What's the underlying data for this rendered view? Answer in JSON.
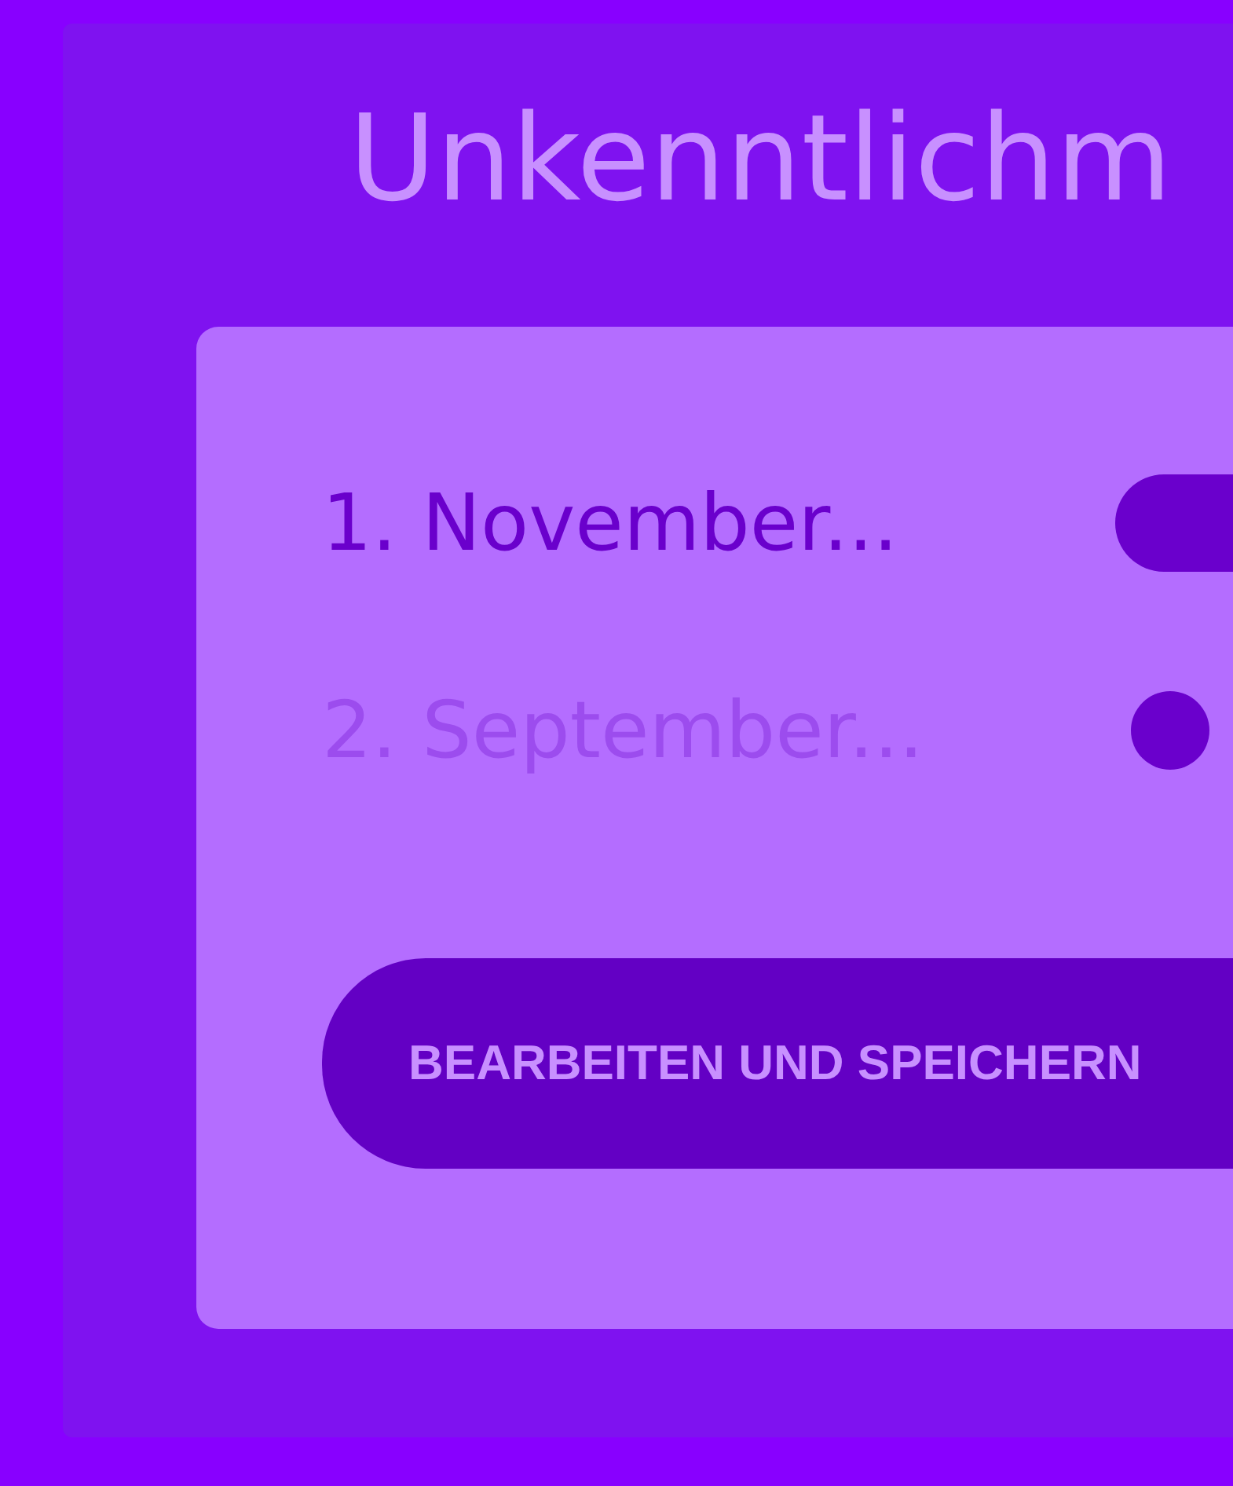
{
  "title": "Unkenntlichm",
  "items": [
    {
      "label": "1. November...",
      "selected": true
    },
    {
      "label": "2. September...",
      "selected": false
    }
  ],
  "button": "BEARBEITEN UND SPEICHERN"
}
